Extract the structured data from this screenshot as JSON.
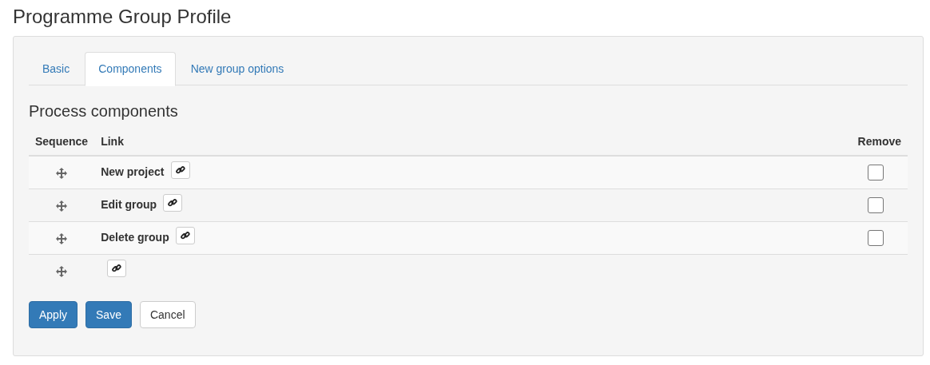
{
  "page_title": "Programme Group Profile",
  "tabs": [
    {
      "label": "Basic",
      "selected": false
    },
    {
      "label": "Components",
      "selected": true
    },
    {
      "label": "New group options",
      "selected": false
    }
  ],
  "section_title": "Process components",
  "table": {
    "columns": [
      "Sequence",
      "Link",
      "Remove"
    ],
    "rows": [
      {
        "label": "New project",
        "remove": {
          "checked": false
        }
      },
      {
        "label": "Edit group",
        "remove": {
          "checked": false
        }
      },
      {
        "label": "Delete group",
        "remove": {
          "checked": false
        }
      },
      {}
    ]
  },
  "buttons": [
    {
      "label": "Apply",
      "kind": "primary"
    },
    {
      "label": "Save",
      "kind": "primary"
    },
    {
      "label": "Cancel",
      "kind": "default"
    }
  ]
}
